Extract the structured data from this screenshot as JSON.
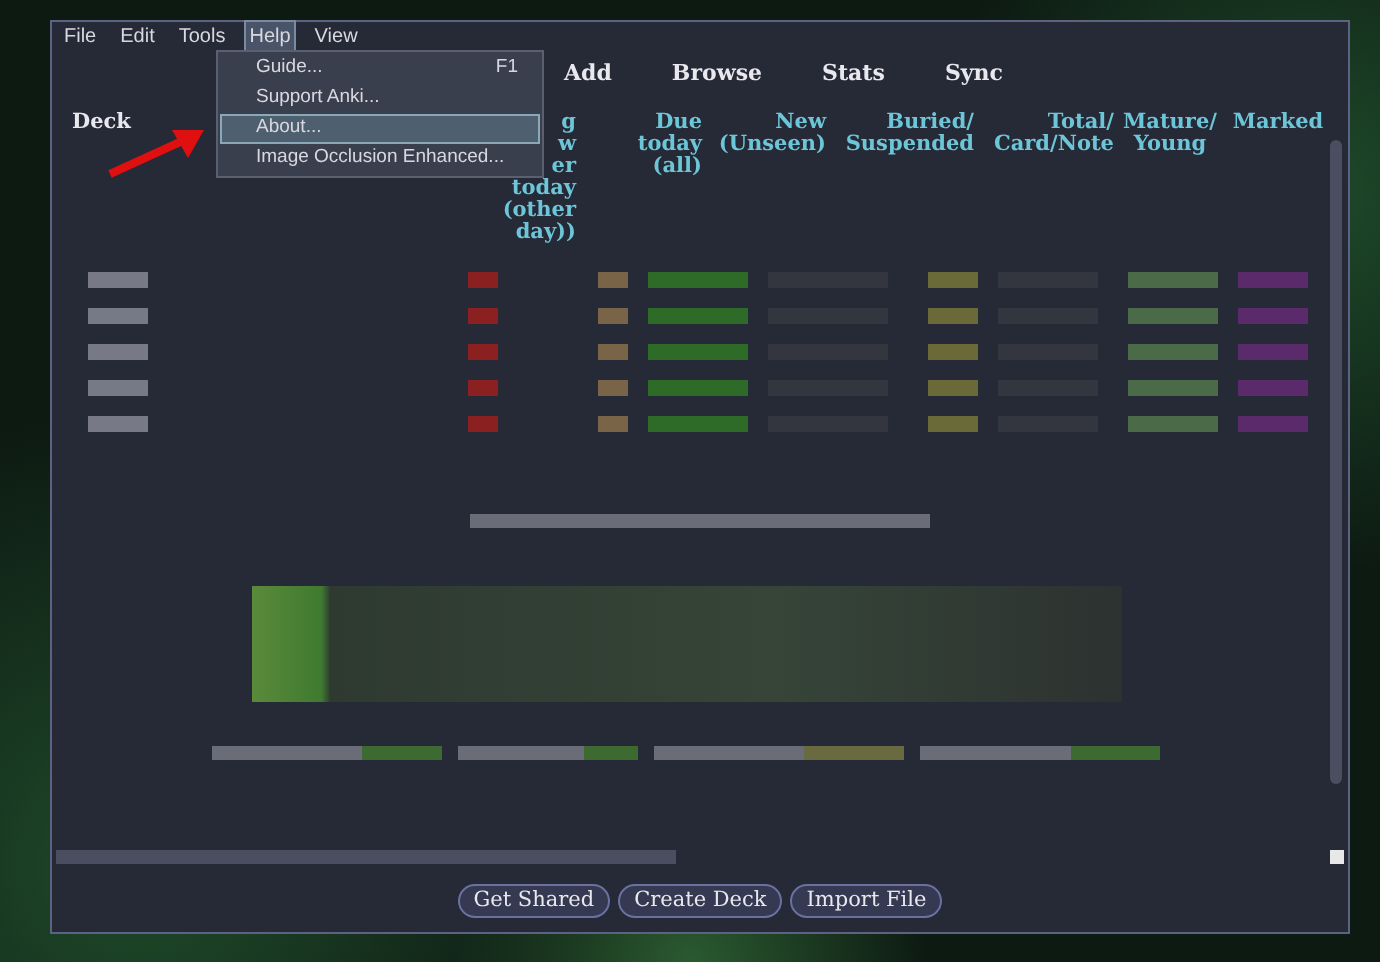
{
  "menu_bar": [
    {
      "label": "File",
      "selected": false
    },
    {
      "label": "Edit",
      "selected": false
    },
    {
      "label": "Tools",
      "selected": false
    },
    {
      "label": "Help",
      "selected": true
    },
    {
      "label": "View",
      "selected": false
    }
  ],
  "help_menu": [
    {
      "label": "Guide...",
      "shortcut": "F1",
      "selected": false
    },
    {
      "label": "Support Anki...",
      "selected": false
    },
    {
      "label": "About...",
      "selected": true
    },
    {
      "label": "Image Occlusion Enhanced...",
      "selected": false
    }
  ],
  "toolbar": [
    "Add",
    "Browse",
    "Stats",
    "Sync"
  ],
  "table": {
    "columns": [
      {
        "lines": [
          "Deck"
        ]
      },
      {
        "lines": [
          "g",
          "w",
          "er",
          "today",
          "(other",
          "day))"
        ]
      },
      {
        "lines": [
          "Due",
          "today",
          "(all)"
        ]
      },
      {
        "lines": [
          "New",
          "(Unseen)"
        ]
      },
      {
        "lines": [
          "Buried/",
          "Suspended"
        ]
      },
      {
        "lines": [
          "Total/",
          "Card/Note"
        ]
      },
      {
        "lines": [
          "Mature/",
          "Young"
        ]
      },
      {
        "lines": [
          "Marked"
        ]
      }
    ]
  },
  "buttons": [
    "Get Shared",
    "Create Deck",
    "Import File"
  ]
}
